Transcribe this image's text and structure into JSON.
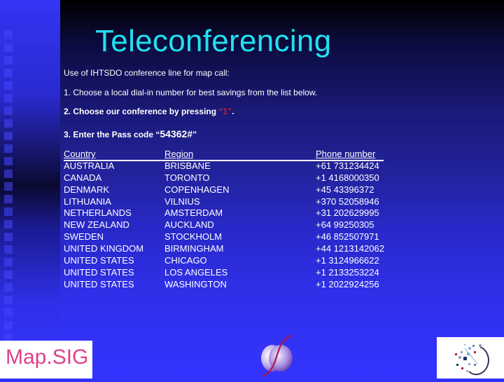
{
  "slide": {
    "title": "Teleconferencing",
    "intro": "Use of IHTSDO conference line for map call:",
    "step1": "1. Choose a local dial-in number for best savings from the list below.",
    "step2_prefix": "2. Choose our conference by pressing ",
    "step2_key": "“1”",
    "step2_suffix": ".",
    "step3_prefix": "3. Enter the Pass code “",
    "step3_code": "54362#",
    "step3_suffix": "”"
  },
  "table": {
    "headers": {
      "country": "Country",
      "region": "Region",
      "phone": "Phone number"
    },
    "rows": [
      {
        "country": "AUSTRALIA",
        "region": "BRISBANE",
        "phone": "+61 731234424"
      },
      {
        "country": "CANADA",
        "region": "TORONTO",
        "phone": "+1 4168000350"
      },
      {
        "country": "DENMARK",
        "region": "COPENHAGEN",
        "phone": "+45 43396372"
      },
      {
        "country": "LITHUANIA",
        "region": "VILNIUS",
        "phone": "+370 52058946"
      },
      {
        "country": "NETHERLANDS",
        "region": "AMSTERDAM",
        "phone": "+31 202629995"
      },
      {
        "country": "NEW ZEALAND",
        "region": "AUCKLAND",
        "phone": "+64 99250305"
      },
      {
        "country": "SWEDEN",
        "region": "STOCKHOLM",
        "phone": "+46 852507971"
      },
      {
        "country": "UNITED KINGDOM",
        "region": "BIRMINGHAM",
        "phone": "+44 1213142062"
      },
      {
        "country": "UNITED STATES",
        "region": "CHICAGO",
        "phone": "+1 3124966622"
      },
      {
        "country": "UNITED STATES",
        "region": "LOS ANGELES",
        "phone": "+1 2133253224"
      },
      {
        "country": "UNITED STATES",
        "region": "WASHINGTON",
        "phone": "+1 2022924256"
      }
    ]
  },
  "footer": {
    "left_logo_text": "Map.SIG",
    "center_logo": "sphere-swoosh-logo-icon",
    "right_logo": "ihtsdo-dots-logo-icon"
  },
  "colors": {
    "title": "#22e0f0",
    "highlight": "#cc2020",
    "logo_text": "#e0408a"
  }
}
